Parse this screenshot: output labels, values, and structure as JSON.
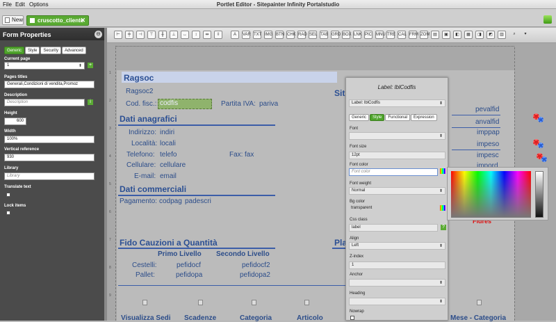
{
  "menubar": {
    "items": [
      "File",
      "Edit",
      "Options"
    ],
    "title": "Portlet Editor - Sitepainter Infinity Portalstudio"
  },
  "tabbar": {
    "new_label": "New",
    "doc_tab": "cruscotto_cliente",
    "close": "✕"
  },
  "form_properties": {
    "title": "Form Properties",
    "close_icon": "⊖",
    "tabs": [
      "Generic",
      "Style",
      "Security",
      "Advanced"
    ],
    "current_page_label": "Current page",
    "current_page_value": "1",
    "add_icon": "+",
    "pages_titles_label": "Pages titles",
    "pages_titles_value": "Generali,Condizioni di vendita,Promoz",
    "description_label": "Description",
    "description_placeholder": "Description",
    "edit_icon": "i",
    "height_label": "Height",
    "height_value": "600",
    "width_label": "Width",
    "width_value": "100%",
    "vref_label": "Vertical reference",
    "vref_value": "930",
    "library_label": "Library",
    "library_placeholder": "Library",
    "translate_label": "Translate text",
    "lock_label": "Lock items"
  },
  "toolbar": {
    "icons": [
      "A",
      "VAR",
      "TXT",
      "IMG",
      "BTN",
      "CHK",
      "RAD",
      "SEL",
      "TAB",
      "GRD",
      "BOX",
      "LNK",
      "PIC",
      "MNU",
      "TRE",
      "CAL",
      "FRM",
      "ZOM"
    ]
  },
  "ruler_marks": [
    "1",
    "2",
    "3",
    "4",
    "5",
    "6",
    "7",
    "8",
    "9"
  ],
  "form": {
    "ragsoc": "Ragsoc",
    "ragsoc2": "Ragsoc2",
    "codfisc_label": "Cod. fisc.:",
    "codfisc_value": "codfis",
    "piva_label": "Partita IVA:",
    "piva_value": "pariva",
    "section_anagrafici": "Dati anagrafici",
    "indirizzo_label": "Indirizzo:",
    "indirizzo_value": "indiri",
    "localita_label": "Località:",
    "localita_value": "locali",
    "telefono_label": "Telefono:",
    "telefono_value": "telefo",
    "fax_label": "Fax:",
    "fax_value": "fax",
    "cellulare_label": "Cellulare:",
    "cellulare_value": "cellulare",
    "email_label": "E-mail:",
    "email_value": "email",
    "section_commerciali": "Dati commerciali",
    "pagamento_label": "Pagamento:",
    "pagamento_value1": "codpag",
    "pagamento_value2": "padescri",
    "section_fido": "Fido Cauzioni a Quantità",
    "primo_livello": "Primo Livello",
    "secondo_livello": "Secondo Livello",
    "cestelli_label": "Cestelli:",
    "cestelli_v1": "pefidocf",
    "cestelli_v2": "pefidocf2",
    "pallet_label": "Pallet:",
    "pallet_v1": "pefidopa",
    "pallet_v2": "pefidopa2",
    "sit_heading": "Sit",
    "pla_heading": "Pla",
    "right_vals": [
      "pevalfid",
      "anvalfid",
      "imppap",
      "impeso",
      "impesc",
      "impord"
    ],
    "fidres": "Fidres",
    "bottom_links": [
      "Visualizza Sedi",
      "Scadenze",
      "Categoria",
      "Articolo",
      "Mese - Categoria"
    ]
  },
  "label_panel": {
    "title": "Label: lblCodfis",
    "select_value": "Label: lblCodfis",
    "tabs": [
      "Generic",
      "Style",
      "Functional",
      "Expression"
    ],
    "font_label": "Font",
    "font_value": "",
    "fontsize_label": "Font size",
    "fontsize_value": "12pt",
    "fontcolor_label": "Font color",
    "fontcolor_placeholder": "Font color",
    "fontweight_label": "Font weight",
    "fontweight_value": "Normal",
    "bgcolor_label": "Bg color",
    "bgcolor_value": "transparent",
    "cssclass_label": "Css class",
    "cssclass_value": "label",
    "help": "?",
    "align_label": "Align",
    "align_value": "Left",
    "zindex_label": "Z-index",
    "zindex_value": "1",
    "anchor_label": "Anchor",
    "anchor_value": "",
    "heading_label": "Heading",
    "heading_value": "",
    "nowrap_label": "Nowrap"
  }
}
